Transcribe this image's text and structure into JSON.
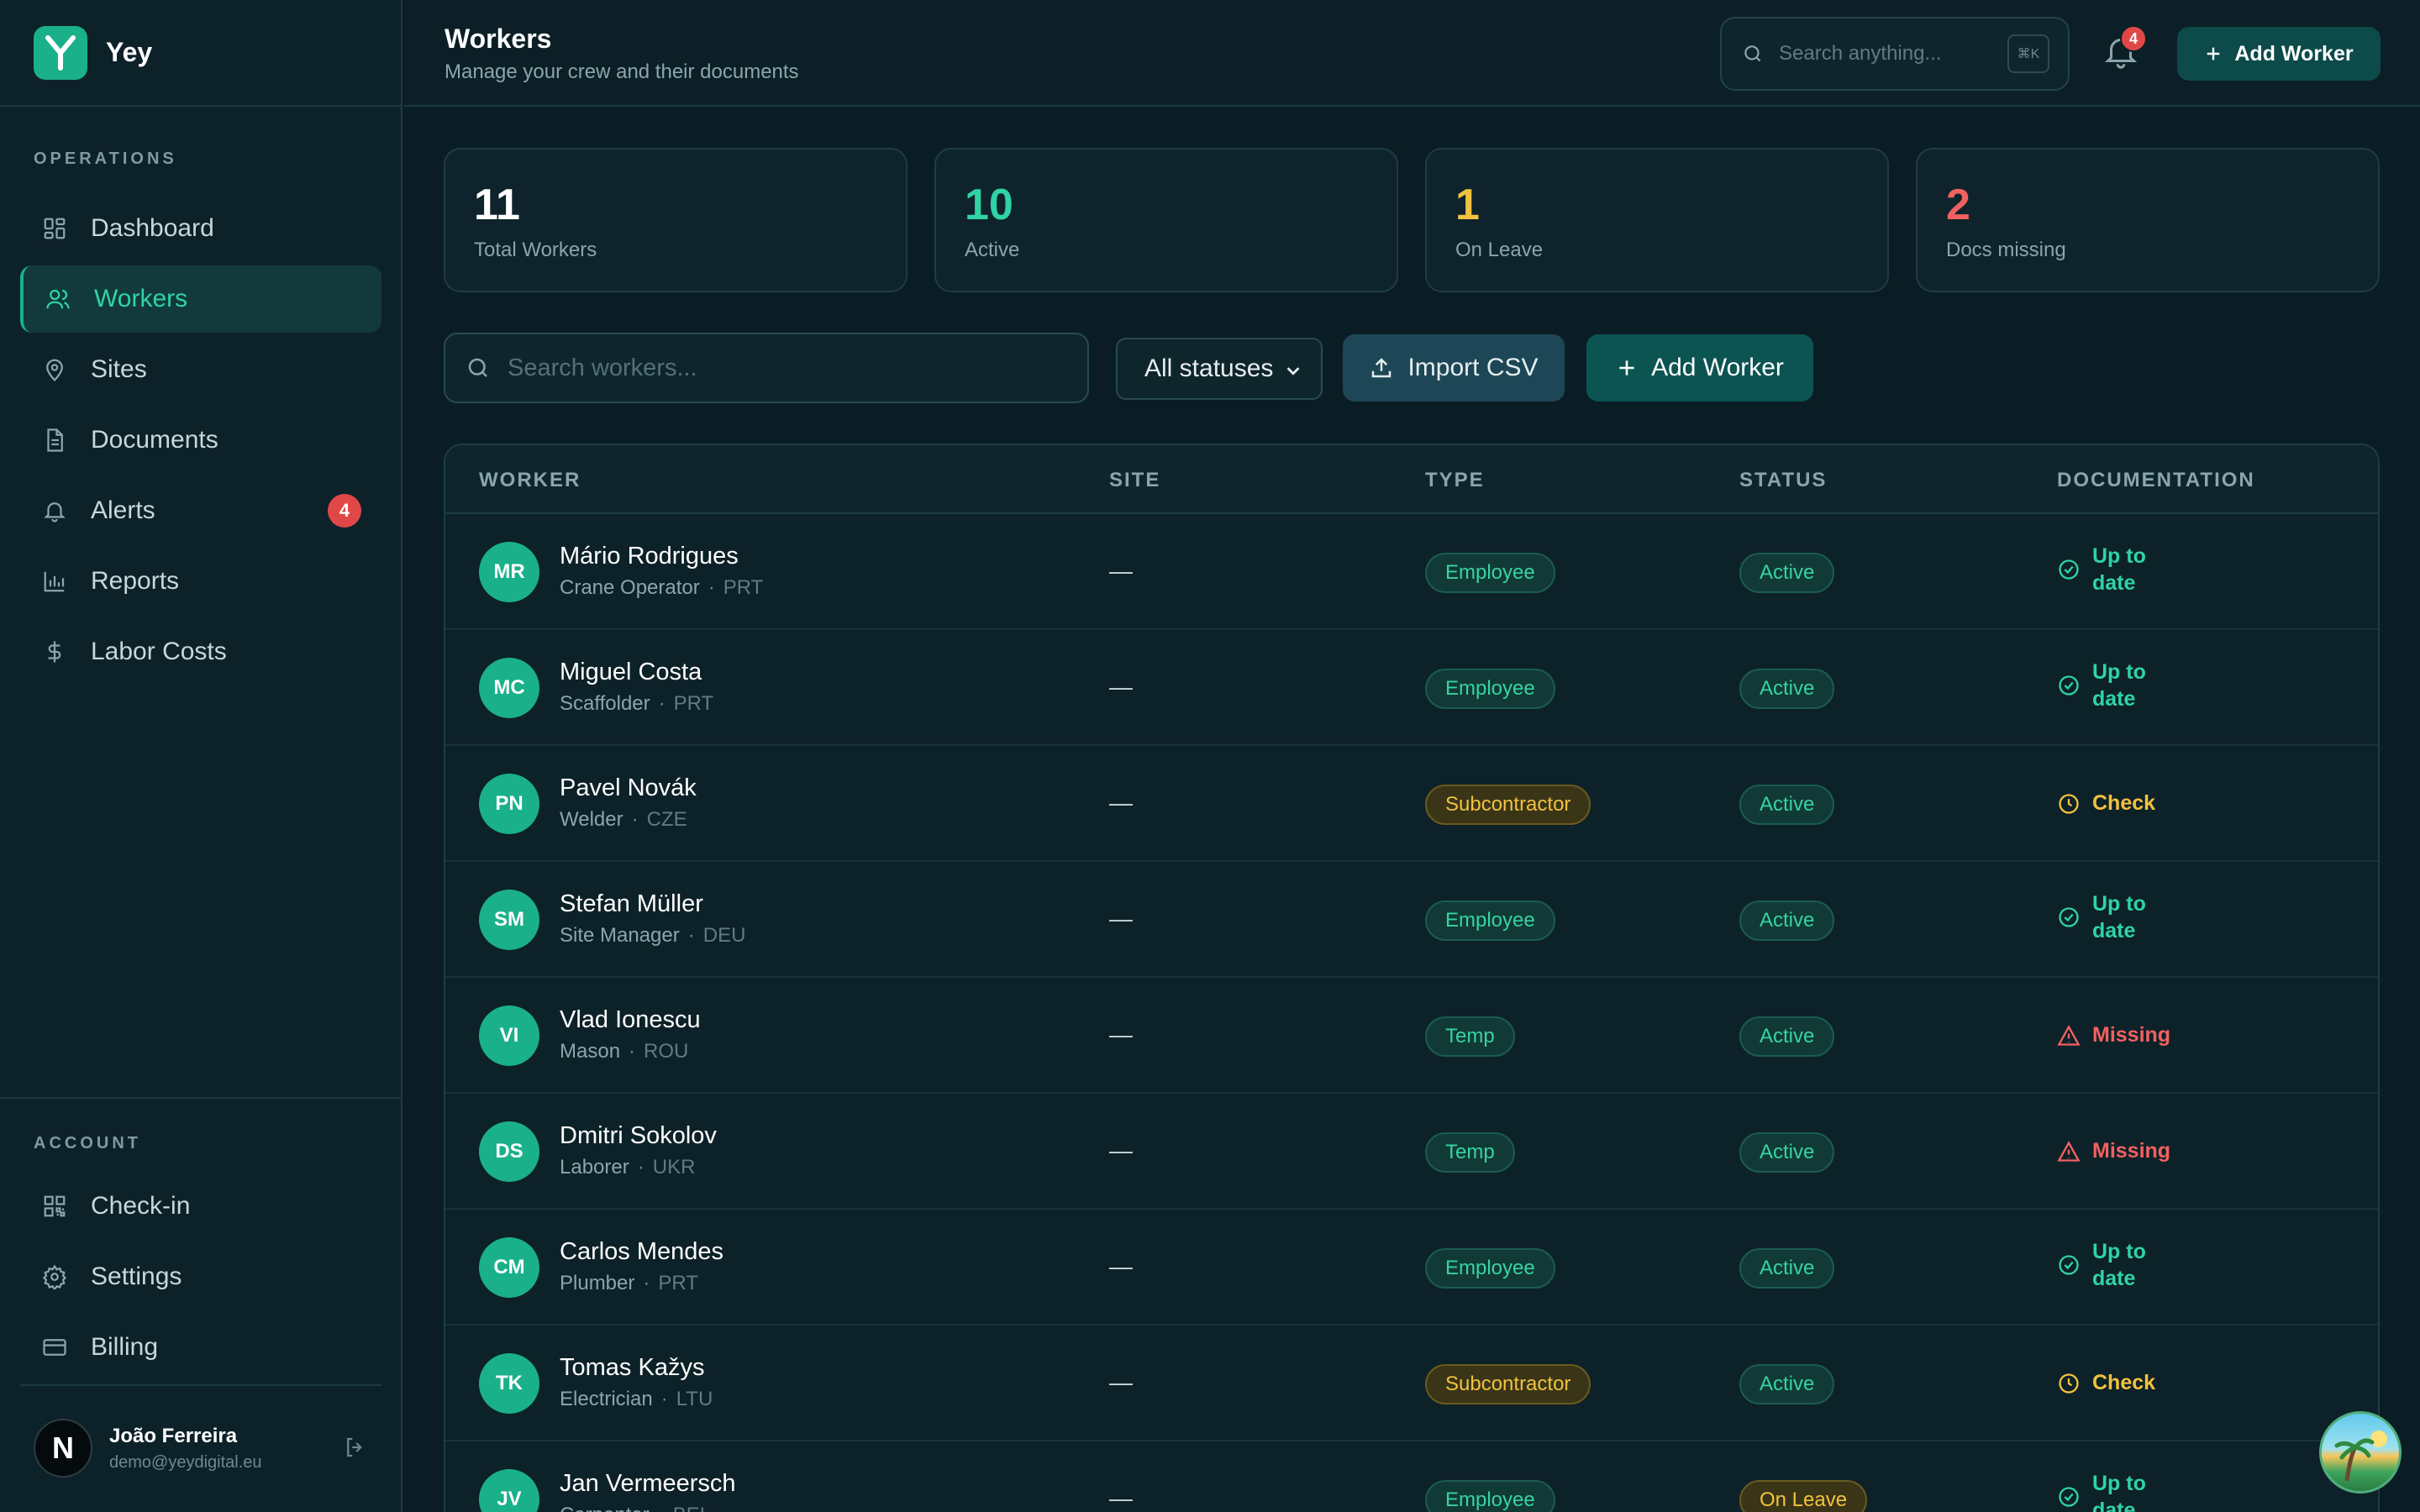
{
  "app": {
    "name": "Yey",
    "logo_letter": "Y",
    "accent": "#1ab08a"
  },
  "sidebar": {
    "operations_label": "OPERATIONS",
    "items": [
      {
        "label": "Dashboard",
        "icon": "dashboard-icon",
        "active": false
      },
      {
        "label": "Workers",
        "icon": "users-icon",
        "active": true
      },
      {
        "label": "Sites",
        "icon": "map-pin-icon",
        "active": false
      },
      {
        "label": "Documents",
        "icon": "document-icon",
        "active": false
      },
      {
        "label": "Alerts",
        "icon": "bell-icon",
        "active": false,
        "badge": "4"
      },
      {
        "label": "Reports",
        "icon": "bar-chart-icon",
        "active": false
      },
      {
        "label": "Labor Costs",
        "icon": "dollar-icon",
        "active": false
      }
    ],
    "account_label": "ACCOUNT",
    "account_items": [
      {
        "label": "Check-in",
        "icon": "qr-code-icon"
      },
      {
        "label": "Settings",
        "icon": "gear-icon"
      },
      {
        "label": "Billing",
        "icon": "credit-card-icon"
      }
    ],
    "user": {
      "initial": "N",
      "name": "João Ferreira",
      "email": "demo@yeydigital.eu"
    }
  },
  "header": {
    "title": "Workers",
    "subtitle": "Manage your crew and their documents",
    "search_placeholder": "Search anything...",
    "search_shortcut": "⌘K",
    "notifications_count": "4",
    "add_button": "Add Worker"
  },
  "stats": [
    {
      "value": "11",
      "label": "Total Workers",
      "color": "#ffffff"
    },
    {
      "value": "10",
      "label": "Active",
      "color": "#2fd4a4"
    },
    {
      "value": "1",
      "label": "On Leave",
      "color": "#f2c23e"
    },
    {
      "value": "2",
      "label": "Docs missing",
      "color": "#f06161"
    }
  ],
  "filters": {
    "search_placeholder": "Search workers...",
    "status_select": "All statuses",
    "import_button": "Import CSV",
    "add_button": "Add Worker"
  },
  "table": {
    "columns": [
      "WORKER",
      "SITE",
      "TYPE",
      "STATUS",
      "DOCUMENTATION"
    ],
    "rows": [
      {
        "initials": "MR",
        "name": "Mário Rodrigues",
        "role": "Crane Operator",
        "country": "PRT",
        "site": "—",
        "type": "Employee",
        "status": "Active",
        "doc": "Up to date",
        "doc_state": "ok"
      },
      {
        "initials": "MC",
        "name": "Miguel Costa",
        "role": "Scaffolder",
        "country": "PRT",
        "site": "—",
        "type": "Employee",
        "status": "Active",
        "doc": "Up to date",
        "doc_state": "ok"
      },
      {
        "initials": "PN",
        "name": "Pavel Novák",
        "role": "Welder",
        "country": "CZE",
        "site": "—",
        "type": "Subcontractor",
        "status": "Active",
        "doc": "Check",
        "doc_state": "check"
      },
      {
        "initials": "SM",
        "name": "Stefan Müller",
        "role": "Site Manager",
        "country": "DEU",
        "site": "—",
        "type": "Employee",
        "status": "Active",
        "doc": "Up to date",
        "doc_state": "ok"
      },
      {
        "initials": "VI",
        "name": "Vlad Ionescu",
        "role": "Mason",
        "country": "ROU",
        "site": "—",
        "type": "Temp",
        "status": "Active",
        "doc": "Missing",
        "doc_state": "miss"
      },
      {
        "initials": "DS",
        "name": "Dmitri Sokolov",
        "role": "Laborer",
        "country": "UKR",
        "site": "—",
        "type": "Temp",
        "status": "Active",
        "doc": "Missing",
        "doc_state": "miss"
      },
      {
        "initials": "CM",
        "name": "Carlos Mendes",
        "role": "Plumber",
        "country": "PRT",
        "site": "—",
        "type": "Employee",
        "status": "Active",
        "doc": "Up to date",
        "doc_state": "ok"
      },
      {
        "initials": "TK",
        "name": "Tomas Kažys",
        "role": "Electrician",
        "country": "LTU",
        "site": "—",
        "type": "Subcontractor",
        "status": "Active",
        "doc": "Check",
        "doc_state": "check"
      },
      {
        "initials": "JV",
        "name": "Jan Vermeersch",
        "role": "Carpenter",
        "country": "BEL",
        "site": "—",
        "type": "Employee",
        "status": "On Leave",
        "doc": "Up to date",
        "doc_state": "ok"
      }
    ]
  }
}
